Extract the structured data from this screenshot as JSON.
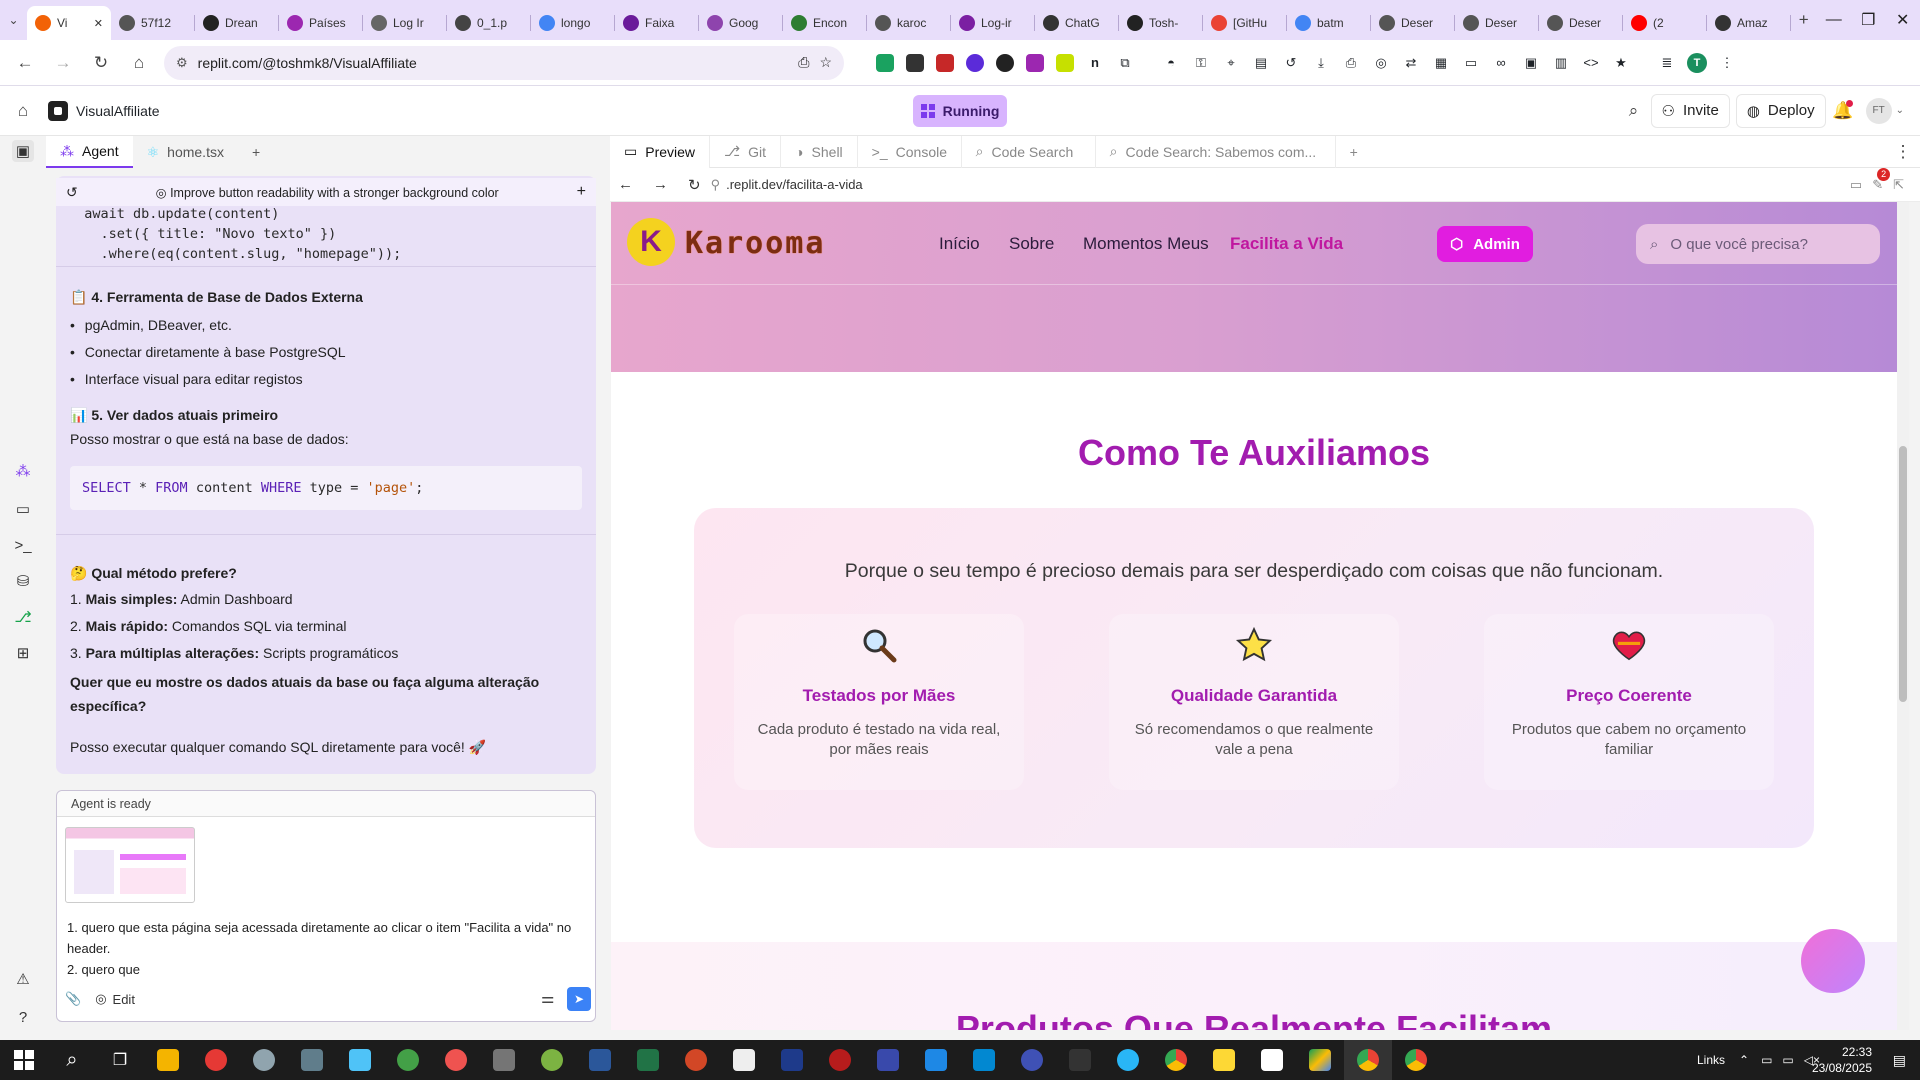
{
  "browser": {
    "tabs": [
      {
        "title": "Vi",
        "color": "#f26207",
        "active": true
      },
      {
        "title": "57f12",
        "color": "#555555"
      },
      {
        "title": "Drean",
        "color": "#222222"
      },
      {
        "title": "Países",
        "color": "#9c27b0"
      },
      {
        "title": "Log Ir",
        "color": "#666666"
      },
      {
        "title": "0_1.p",
        "color": "#444444"
      },
      {
        "title": "longo",
        "color": "#4285f4"
      },
      {
        "title": "Faixa",
        "color": "#6a1b9a"
      },
      {
        "title": "Goog",
        "color": "#8e44ad"
      },
      {
        "title": "Encon",
        "color": "#2e7d32"
      },
      {
        "title": "karoc",
        "color": "#555555"
      },
      {
        "title": "Log-ir",
        "color": "#7b1fa2"
      },
      {
        "title": "ChatG",
        "color": "#333333"
      },
      {
        "title": "Tosh-",
        "color": "#222222"
      },
      {
        "title": "[GitHu",
        "color": "#ea4335"
      },
      {
        "title": "batm",
        "color": "#4285f4"
      },
      {
        "title": "Deser",
        "color": "#555555"
      },
      {
        "title": "Deser",
        "color": "#555555"
      },
      {
        "title": "Deser",
        "color": "#555555"
      },
      {
        "title": "(2",
        "color": "#ff0000"
      },
      {
        "title": "Amaz",
        "color": "#333333"
      }
    ],
    "url": "replit.com/@toshmk8/VisualAffiliate",
    "profile_initial": "T"
  },
  "replit": {
    "project_name": "VisualAffiliate",
    "running_label": "Running",
    "invite_label": "Invite",
    "deploy_label": "Deploy",
    "user_initials": "FT"
  },
  "left_panel": {
    "tabs": [
      {
        "label": "Agent"
      },
      {
        "label": "home.tsx"
      }
    ],
    "chat_header": "Improve button readability with a stronger background color",
    "code_lines": [
      "  await db.update(content)",
      "    .set({ title: \"Novo texto\" })",
      "    .where(eq(content.slug, \"homepage\"));"
    ],
    "section4_title": "4. Ferramenta de Base de Dados Externa",
    "section4_items": [
      "pgAdmin, DBeaver, etc.",
      "Conectar diretamente à base PostgreSQL",
      "Interface visual para editar registos"
    ],
    "section5_title": "5. Ver dados atuais primeiro",
    "section5_text": "Posso mostrar o que está na base de dados:",
    "sql": {
      "kw1": "SELECT",
      "mid1": " * ",
      "kw2": "FROM",
      "mid2": " content ",
      "kw3": "WHERE",
      "mid3": " type = ",
      "str": "'page'",
      "end": ";"
    },
    "question_title": "Qual método prefere?",
    "options": [
      {
        "num": "1.",
        "bold": "Mais simples:",
        "rest": " Admin Dashboard"
      },
      {
        "num": "2.",
        "bold": "Mais rápido:",
        "rest": " Comandos SQL via terminal"
      },
      {
        "num": "3.",
        "bold": "Para múltiplas alterações:",
        "rest": " Scripts programáticos"
      }
    ],
    "closing_bold": "Quer que eu mostre os dados atuais da base ou faça alguma alteração específica?",
    "closing_text": "Posso executar qualquer comando SQL diretamente para você! 🚀",
    "composer_status": "Agent is ready",
    "composer_text_1": "1. quero que esta página seja acessada diretamente ao clicar o item \"Facilita a vida\" no header.",
    "composer_text_2": "2. quero que",
    "edit_label": "Edit"
  },
  "preview": {
    "tabs": [
      {
        "label": "Preview",
        "active": true
      },
      {
        "label": "Git"
      },
      {
        "label": "Shell"
      },
      {
        "label": "Console"
      },
      {
        "label": "Code Search"
      },
      {
        "label": "Code Search: Sabemos com..."
      }
    ],
    "url": ".replit.dev/facilita-a-vida",
    "badge_count": "2",
    "site": {
      "logo_text": "Karooma",
      "nav": [
        "Início",
        "Sobre",
        "Momentos Meus",
        "Facilita a Vida"
      ],
      "admin_label": "Admin",
      "search_placeholder": "O que você precisa?",
      "section_title": "Como Te Auxiliamos",
      "section_subtitle": "Porque o seu tempo é precioso demais para ser desperdiçado com coisas que não funcionam.",
      "features": [
        {
          "icon": "magnifier-icon",
          "title": "Testados por Mães",
          "desc": "Cada produto é testado na vida real, por mães reais"
        },
        {
          "icon": "star-icon",
          "title": "Qualidade Garantida",
          "desc": "Só recomendamos o que realmente vale a pena"
        },
        {
          "icon": "heart-icon",
          "title": "Preço Coerente",
          "desc": "Produtos que cabem no orçamento familiar"
        }
      ],
      "next_title": "Produtos Que Realmente Facilitam",
      "accent": "#a21caf"
    }
  },
  "taskbar": {
    "time": "22:33",
    "date": "23/08/2025",
    "links_label": "Links"
  }
}
